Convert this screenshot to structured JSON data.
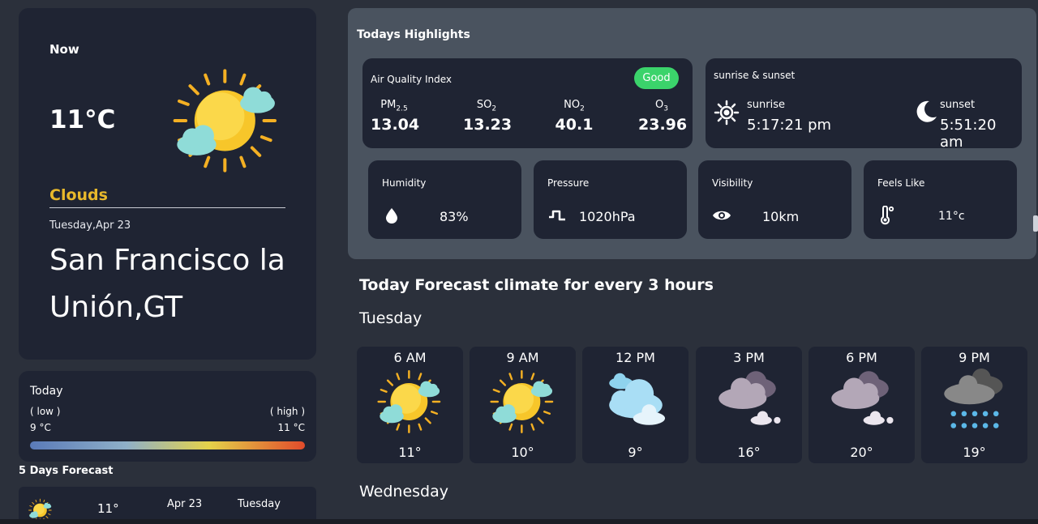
{
  "current": {
    "label": "Now",
    "temp": "11°C",
    "description": "Clouds",
    "date": "Tuesday,Apr 23",
    "city": "San Francisco la Unión,GT",
    "icon": "sun-cloud-icon"
  },
  "today": {
    "title": "Today",
    "low_label": "( low )",
    "high_label": "( high )",
    "low": "9 °C",
    "high": "11 °C"
  },
  "five_day": {
    "title": "5 Days Forecast",
    "rows": [
      {
        "icon": "sun-cloud-icon",
        "temp": "11°",
        "date": "Apr 23",
        "day": "Tuesday"
      }
    ]
  },
  "highlights": {
    "title": "Todays Highlights",
    "aqi": {
      "label": "Air Quality Index",
      "status": "Good",
      "status_color": "#3bd36b",
      "items": [
        {
          "name": "PM",
          "sub": "2.5",
          "value": "13.04"
        },
        {
          "name": "SO",
          "sub": "2",
          "value": "13.23"
        },
        {
          "name": "NO",
          "sub": "2",
          "value": "40.1"
        },
        {
          "name": "O",
          "sub": "3",
          "value": "23.96"
        }
      ]
    },
    "sun": {
      "title": "sunrise & sunset",
      "sunrise_label": "sunrise",
      "sunrise": "5:17:21 pm",
      "sunset_label": "sunset",
      "sunset": "5:51:20 am"
    },
    "stats": [
      {
        "label": "Humidity",
        "value": "83%",
        "icon": "droplet-icon"
      },
      {
        "label": "Pressure",
        "value": "1020hPa",
        "icon": "pressure-wave-icon"
      },
      {
        "label": "Visibility",
        "value": "10km",
        "icon": "eye-icon"
      },
      {
        "label": "Feels Like",
        "value": "11°c",
        "icon": "thermometer-icon"
      }
    ]
  },
  "hourly": {
    "title": "Today Forecast climate for every 3 hours",
    "day1": "Tuesday",
    "day2": "Wednesday",
    "items": [
      {
        "time": "6 AM",
        "temp": "11°",
        "icon": "sun-cloud-icon"
      },
      {
        "time": "9 AM",
        "temp": "10°",
        "icon": "sun-cloud-icon"
      },
      {
        "time": "12 PM",
        "temp": "9°",
        "icon": "clouds-icon"
      },
      {
        "time": "3 PM",
        "temp": "16°",
        "icon": "dark-clouds-icon"
      },
      {
        "time": "6 PM",
        "temp": "20°",
        "icon": "dark-clouds-icon"
      },
      {
        "time": "9 PM",
        "temp": "19°",
        "icon": "rain-cloud-icon"
      }
    ]
  },
  "colors": {
    "accent_yellow": "#e8b92b",
    "card_bg": "#1f2433",
    "page_bg": "#2b303b",
    "panel_bg": "#4a535f"
  }
}
